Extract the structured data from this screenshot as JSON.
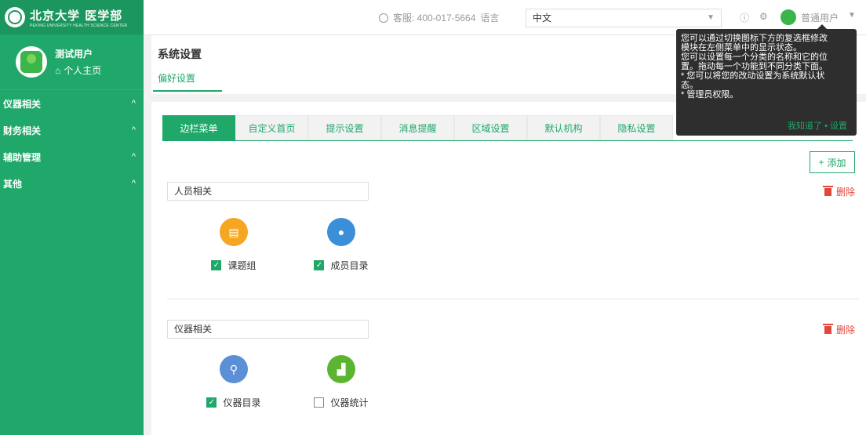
{
  "sidebar": {
    "logo_text": "北京大学 医学部",
    "logo_subtext": "PEKING UNIVERSITY HEALTH SCIENCE CENTER",
    "user_name": "测试用户",
    "home_link": "个人主页",
    "menu": [
      {
        "label": "仪器相关",
        "chevron": "^"
      },
      {
        "label": "财务相关",
        "chevron": "^"
      },
      {
        "label": "辅助管理",
        "chevron": "^"
      },
      {
        "label": "其他",
        "chevron": "^"
      }
    ]
  },
  "topbar": {
    "service": "客服: 400-017-5664",
    "language_label": "语言",
    "language_value": "中文",
    "info_icon": "ⓘ",
    "settings_icon": "⚙",
    "user_role": "普通用户"
  },
  "page": {
    "title": "系统设置",
    "subtab": "偏好设置"
  },
  "tabs": [
    "边栏菜单",
    "自定义首页",
    "提示设置",
    "消息提醒",
    "区域设置",
    "默认机构",
    "隐私设置"
  ],
  "add_button": "添加",
  "groups": [
    {
      "name": "人员相关",
      "delete_label": "删除",
      "items": [
        {
          "label": "课题组",
          "checked": true,
          "icon": "book-icon",
          "color": "#f5a623"
        },
        {
          "label": "成员目录",
          "checked": true,
          "icon": "people-icon",
          "color": "#3b8fd9"
        }
      ]
    },
    {
      "name": "仪器相关",
      "delete_label": "删除",
      "items": [
        {
          "label": "仪器目录",
          "checked": true,
          "icon": "microscope-icon",
          "color": "#5b8fd6"
        },
        {
          "label": "仪器统计",
          "checked": false,
          "icon": "chart-icon",
          "color": "#5cb530"
        }
      ]
    }
  ],
  "tooltip": {
    "lines": [
      "您可以通过切换图标下方的复选框修改",
      "模块在左侧菜单中的显示状态。",
      "您可以设置每一个分类的名称和它的位",
      "置。拖动每一个功能到不同分类下面。",
      "* 您可以将您的改动设置为系统默认状",
      "态。",
      "* 管理员权限。"
    ],
    "action_ok": "我知道了",
    "action_sep": "•",
    "action_settings": "设置"
  },
  "colors": {
    "primary": "#1fa86a",
    "danger": "#e0483c",
    "tooltip_bg": "#2e2e2e"
  }
}
